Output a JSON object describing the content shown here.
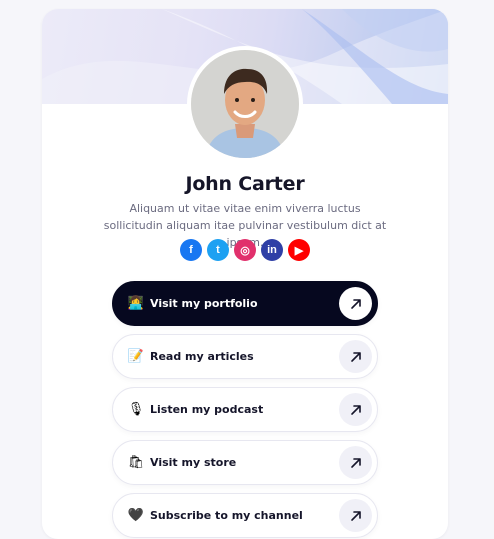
{
  "profile": {
    "name": "John Carter",
    "bio": "Aliquam ut vitae vitae enim viverra luctus sollicitudin aliquam itae pulvinar vestibulum dict at ipsum."
  },
  "socials": [
    {
      "icon": "facebook-icon",
      "glyph": "f",
      "color": "#1877f2"
    },
    {
      "icon": "twitter-icon",
      "glyph": "t",
      "color": "#1da1f2"
    },
    {
      "icon": "instagram-icon",
      "glyph": "◎",
      "color": "#e1306c"
    },
    {
      "icon": "linkedin-icon",
      "glyph": "in",
      "color": "#2f3fa6"
    },
    {
      "icon": "youtube-icon",
      "glyph": "▶",
      "color": "#ff0000"
    }
  ],
  "links": [
    {
      "label": "Visit my portfolio",
      "emoji": "👩‍💻"
    },
    {
      "label": "Read my articles",
      "emoji": "📝"
    },
    {
      "label": "Listen my podcast",
      "emoji": "🎙"
    },
    {
      "label": "Visit my store",
      "emoji": "🛍"
    },
    {
      "label": "Subscribe to my channel",
      "emoji": "🖤"
    }
  ]
}
